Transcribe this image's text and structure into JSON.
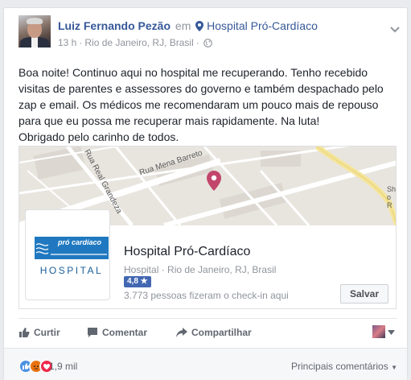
{
  "header": {
    "author": "Luiz Fernando Pezão",
    "connector": "em",
    "place": "Hospital Pró-Cardíaco",
    "time": "13 h",
    "location": "Rio de Janeiro, RJ, Brasil"
  },
  "post": {
    "lines": [
      "Boa noite! Continuo aqui no hospital me recuperando. Tenho recebido visitas de parentes e assessores do governo e também despachado pelo zap e email. Os médicos me recomendaram um pouco mais de repouso para que eu possa me recuperar mais rapidamente. Na luta!",
      "Obrigado pelo carinho de todos."
    ]
  },
  "map": {
    "street_1": "Rua Mena Barreto",
    "street_2": "Rua Real Grandeza",
    "edge_label": "Sho R"
  },
  "business": {
    "name": "Hospital Pró-Cardíaco",
    "category": "Hospital",
    "location": "Rio de Janeiro, RJ, Brasil",
    "rating": "4,8 ★",
    "checkins": "3.773 pessoas fizeram o check-in aqui",
    "save_label": "Salvar",
    "logo_text": "HOSPITAL",
    "logo_brand": "pró cardíaco"
  },
  "actions": {
    "like": "Curtir",
    "comment": "Comentar",
    "share": "Compartilhar"
  },
  "footer": {
    "reaction_count": "1,9 mil",
    "sort_label": "Principais comentários"
  },
  "colors": {
    "link": "#365899",
    "accent": "#4267b2",
    "pin": "#c2466b",
    "logo_blue": "#2079c0"
  },
  "icons": [
    "pin-icon",
    "globe-icon",
    "chevron-down-icon",
    "like-icon",
    "comment-icon",
    "share-icon"
  ]
}
